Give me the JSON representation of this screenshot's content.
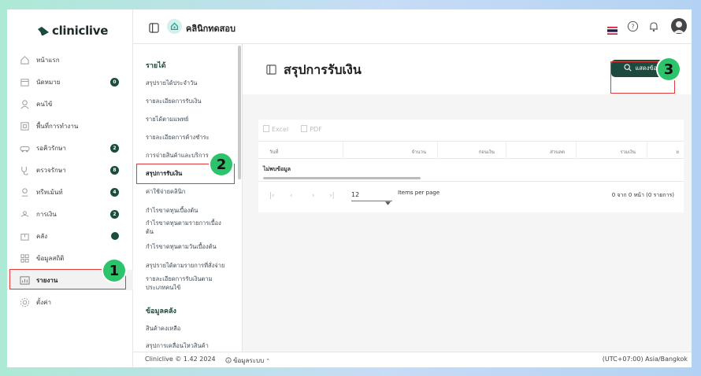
{
  "brand": {
    "logo_text": "cliniclive"
  },
  "header": {
    "clinic_name": "คลินิกทดสอบ"
  },
  "sidebar": {
    "items": [
      {
        "label": "หน้าแรก",
        "icon": "home-icon"
      },
      {
        "label": "นัดหมาย",
        "icon": "calendar-icon",
        "badge": "0"
      },
      {
        "label": "คนไข้",
        "icon": "user-icon"
      },
      {
        "label": "พื้นที่การทำงาน",
        "icon": "workspace-icon"
      },
      {
        "label": "รอคิวรักษา",
        "icon": "car-icon",
        "badge": "2"
      },
      {
        "label": "ตรวจรักษา",
        "icon": "stethoscope-icon",
        "badge": "8"
      },
      {
        "label": "ทรีทเม้นท์",
        "icon": "treatment-icon",
        "badge": "4"
      },
      {
        "label": "การเงิน",
        "icon": "money-icon",
        "badge": "2"
      },
      {
        "label": "คลัง",
        "icon": "box-icon",
        "dot": true
      },
      {
        "label": "ข้อมูลสถิติ",
        "icon": "stats-icon"
      },
      {
        "label": "รายงาน",
        "icon": "report-icon"
      },
      {
        "label": "ตั้งค่า",
        "icon": "gear-icon"
      }
    ]
  },
  "submenu": {
    "section_income": "รายได้",
    "items": [
      "สรุปรายได้ประจำวัน",
      "รายละเอียดการรับเงิน",
      "รายได้ตามแพทย์",
      "รายละเอียดการค้างชำระ",
      "การจ่ายสินค้าและบริการ",
      "สรุปการรับเงิน",
      "ค่าใช้จ่ายคลินิก",
      "กำไรขาดทุนเบื้องต้น",
      "กำไรขาดทุนตามรายการเบื้องต้น",
      "กำไรขาดทุนตามวันเบื้องต้น",
      "สรุปรายได้ตามรายการที่สั่งจ่าย",
      "รายละเอียดการรับเงินตามประเภทคนไข้"
    ],
    "section_stock": "ข้อมูลคลัง",
    "stock_items": [
      "สินค้าคงเหลือ",
      "สรุปการเคลื่อนไหวสินค้า"
    ]
  },
  "page": {
    "title": "สรุปการรับเงิน",
    "show_button": "แสดงข้อมูล",
    "export_excel": "Excel",
    "export_pdf": "PDF",
    "columns": [
      "วันที่",
      "จำนวน",
      "ก่อนเงิน",
      "ส่วนลด",
      "รวมเงิน",
      "ย"
    ],
    "no_data": "ไม่พบข้อมูล",
    "page_size": "12",
    "items_per_page": "Items per page",
    "page_info": "0 จาก 0 หน้า (0 รายการ)"
  },
  "footer": {
    "copyright": "Cliniclive © 1.42 2024",
    "system_info": "ข้อมูลระบบ",
    "timezone": "(UTC+07:00) Asia/Bangkok"
  },
  "markers": {
    "m1": "1",
    "m2": "2",
    "m3": "3"
  },
  "colors": {
    "accent": "#1d4a3e",
    "marker": "#2dc36a",
    "highlight": "#e23b3b"
  }
}
